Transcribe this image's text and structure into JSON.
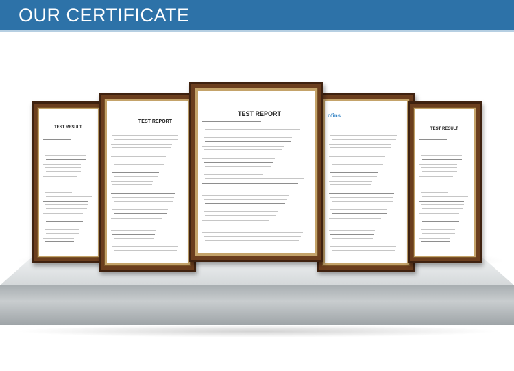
{
  "banner": {
    "title": "OUR CERTIFICATE"
  },
  "certificates": [
    {
      "heading": "TEST RESULT",
      "logo": ""
    },
    {
      "heading": "TEST REPORT",
      "logo": ""
    },
    {
      "heading": "TEST REPORT",
      "logo": ""
    },
    {
      "heading": "",
      "logo": "ofins"
    },
    {
      "heading": "TEST RESULT",
      "logo": ""
    }
  ],
  "colors": {
    "banner": "#2d72a8",
    "frame": "#6b3e1e",
    "shelf": "#c9cdcf"
  }
}
